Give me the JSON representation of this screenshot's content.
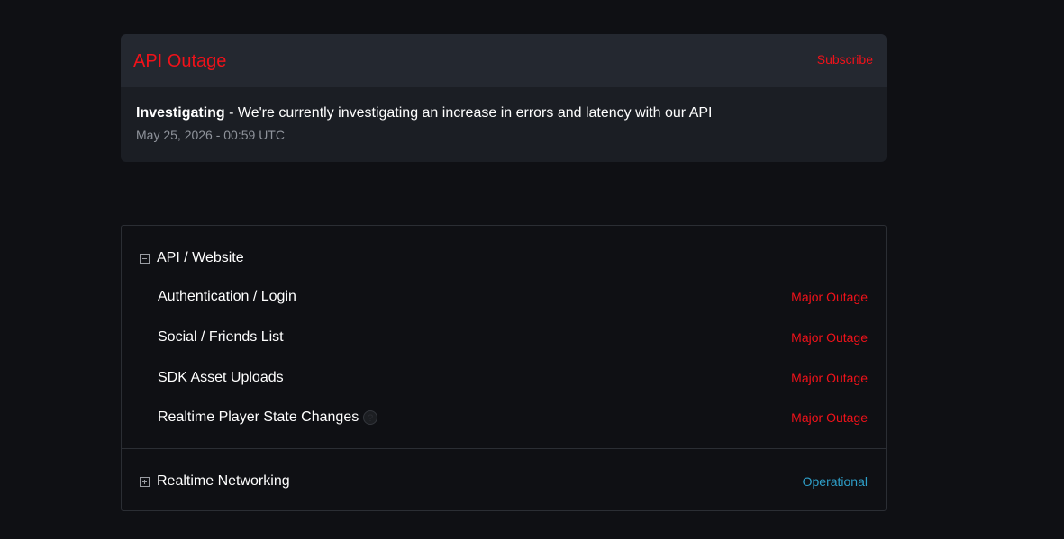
{
  "incident": {
    "title": "API Outage",
    "subscribe_label": "Subscribe",
    "status_word": "Investigating",
    "message": " - We're currently investigating an increase in errors and latency with our API",
    "timestamp": "May 25, 2026 - 00:59 UTC"
  },
  "colors": {
    "major_outage": "#f0121a",
    "operational": "#2e9fc9"
  },
  "groups": [
    {
      "name": "API / Website",
      "expanded": true,
      "icon": "collapse-minus-icon",
      "components": [
        {
          "name": "Authentication / Login",
          "status": "Major Outage"
        },
        {
          "name": "Social / Friends List",
          "status": "Major Outage"
        },
        {
          "name": "SDK Asset Uploads",
          "status": "Major Outage"
        },
        {
          "name": "Realtime Player State Changes",
          "status": "Major Outage",
          "has_help": true,
          "help_glyph": "?"
        }
      ]
    },
    {
      "name": "Realtime Networking",
      "expanded": false,
      "icon": "expand-plus-icon",
      "status": "Operational"
    }
  ]
}
